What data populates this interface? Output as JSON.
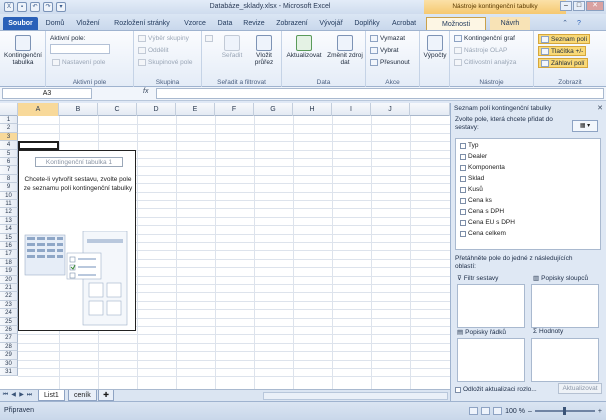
{
  "window": {
    "title": "Databáze_sklady.xlsx - Microsoft Excel",
    "context_title": "Nástroje kontingenční tabulky"
  },
  "tabs": {
    "file": "Soubor",
    "items": [
      "Domů",
      "Vložení",
      "Rozložení stránky",
      "Vzorce",
      "Data",
      "Revize",
      "Zobrazení",
      "Vývojář",
      "Doplňky",
      "Acrobat",
      "Možnosti",
      "Návrh"
    ],
    "active": "Možnosti"
  },
  "ribbon": {
    "pivot_table": {
      "label": "Kontingenční tabulka",
      "group": ""
    },
    "active_field": {
      "label": "Aktivní pole:",
      "settings": "Nastavení pole",
      "group": "Aktivní pole"
    },
    "group": {
      "selection": "Výběr skupiny",
      "ungroup": "Oddělit",
      "field": "Skupinové pole",
      "group": "Skupina"
    },
    "sort": {
      "sort_label": "Seřadit",
      "slicer_label": "Vložit průřez",
      "group": "Seřadit a filtrovat"
    },
    "data": {
      "refresh": "Aktualizovat",
      "change_source": "Změnit zdroj dat",
      "group": "Data"
    },
    "actions": {
      "clear": "Vymazat",
      "select": "Vybrat",
      "move": "Přesunout",
      "group": "Akce"
    },
    "calc": {
      "label": "Výpočty"
    },
    "tools": {
      "chart": "Kontingenční graf",
      "olap": "Nástroje OLAP",
      "whatif": "Citlivostní analýza",
      "group": "Nástroje"
    },
    "show": {
      "field_list": "Seznam polí",
      "buttons": "Tlačítka +/-",
      "headers": "Záhlaví polí",
      "group": "Zobrazit"
    }
  },
  "formula_bar": {
    "name_box": "A3",
    "fx": "fx",
    "content": ""
  },
  "grid": {
    "columns": [
      "A",
      "B",
      "C",
      "D",
      "E",
      "F",
      "G",
      "H",
      "I",
      "J"
    ],
    "rows": [
      "1",
      "2",
      "3",
      "4",
      "5",
      "6",
      "7",
      "8",
      "9",
      "10",
      "11",
      "12",
      "13",
      "14",
      "15",
      "16",
      "17",
      "18",
      "19",
      "20",
      "21",
      "22",
      "23",
      "24",
      "25",
      "26",
      "27",
      "28",
      "29",
      "30",
      "31"
    ],
    "selected_column": "A",
    "selected_row": "3"
  },
  "pivot_placeholder": {
    "title": "Kontingenční tabulka 1",
    "instruction": "Chcete-li vytvořit sestavu, zvolte pole ze seznamu polí kontingenční tabulky"
  },
  "sheets": {
    "tabs": [
      "List1",
      "ceník"
    ],
    "active": "List1"
  },
  "field_pane": {
    "title": "Seznam polí kontingenční tabulky",
    "instruction": "Zvolte pole, která chcete přidat do sestavy:",
    "fields": [
      "Typ",
      "Dealer",
      "Komponenta",
      "Sklad",
      "Kusů",
      "Cena ks",
      "Cena s DPH",
      "Cena EU s DPH",
      "Cena celkem"
    ],
    "drag_instruction": "Přetáhněte pole do jedné z následujících oblastí:",
    "areas": {
      "filter": "Filtr sestavy",
      "columns": "Popisky sloupců",
      "rows": "Popisky řádků",
      "values": "Hodnoty"
    },
    "defer": "Odložit aktualizaci rozlo...",
    "update": "Aktualizovat"
  },
  "status": {
    "text": "Připraven",
    "zoom": "100 %"
  },
  "colors": {
    "file_tab": "#2a60b8",
    "context": "#f5c870",
    "highlight": "#f9d977"
  }
}
